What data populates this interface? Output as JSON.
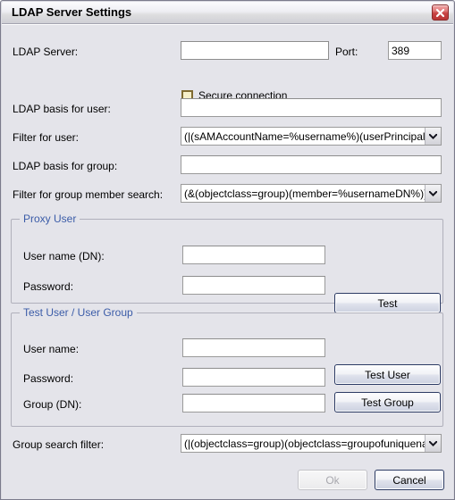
{
  "window": {
    "title": "LDAP Server Settings",
    "close_icon": "close-icon"
  },
  "form": {
    "ldap_server_label": "LDAP Server:",
    "ldap_server_value": "",
    "port_label": "Port:",
    "port_value": "389",
    "secure_connection_label": "Secure connection",
    "secure_connection_checked": false,
    "ldap_basis_user_label": "LDAP basis for user:",
    "ldap_basis_user_value": "",
    "filter_user_label": "Filter for user:",
    "filter_user_value": "(|(sAMAccountName=%username%)(userPrincipalName=%",
    "ldap_basis_group_label": "LDAP basis for group:",
    "ldap_basis_group_value": "",
    "filter_group_member_label": "Filter for group member search:",
    "filter_group_member_value": "(&(objectclass=group)(member=%usernameDN%))",
    "group_search_filter_label": "Group search filter:",
    "group_search_filter_value": "(|(objectclass=group)(objectclass=groupofuniquenames))"
  },
  "proxy_user": {
    "legend": "Proxy User",
    "username_label": "User name (DN):",
    "username_value": "",
    "password_label": "Password:",
    "password_value": "",
    "test_button": "Test"
  },
  "test_user": {
    "legend": "Test User / User Group",
    "username_label": "User name:",
    "username_value": "",
    "password_label": "Password:",
    "password_value": "",
    "group_label": "Group (DN):",
    "group_value": "",
    "test_user_button": "Test User",
    "test_group_button": "Test Group"
  },
  "footer": {
    "ok_label": "Ok",
    "ok_enabled": false,
    "cancel_label": "Cancel",
    "cancel_enabled": true
  },
  "colors": {
    "dialog_bg": "#e4e4ea",
    "legend_blue": "#3b5ca8",
    "close_red": "#c84444",
    "checkbox_border": "#7f6a30",
    "checkbox_fill": "#f6efc9"
  }
}
